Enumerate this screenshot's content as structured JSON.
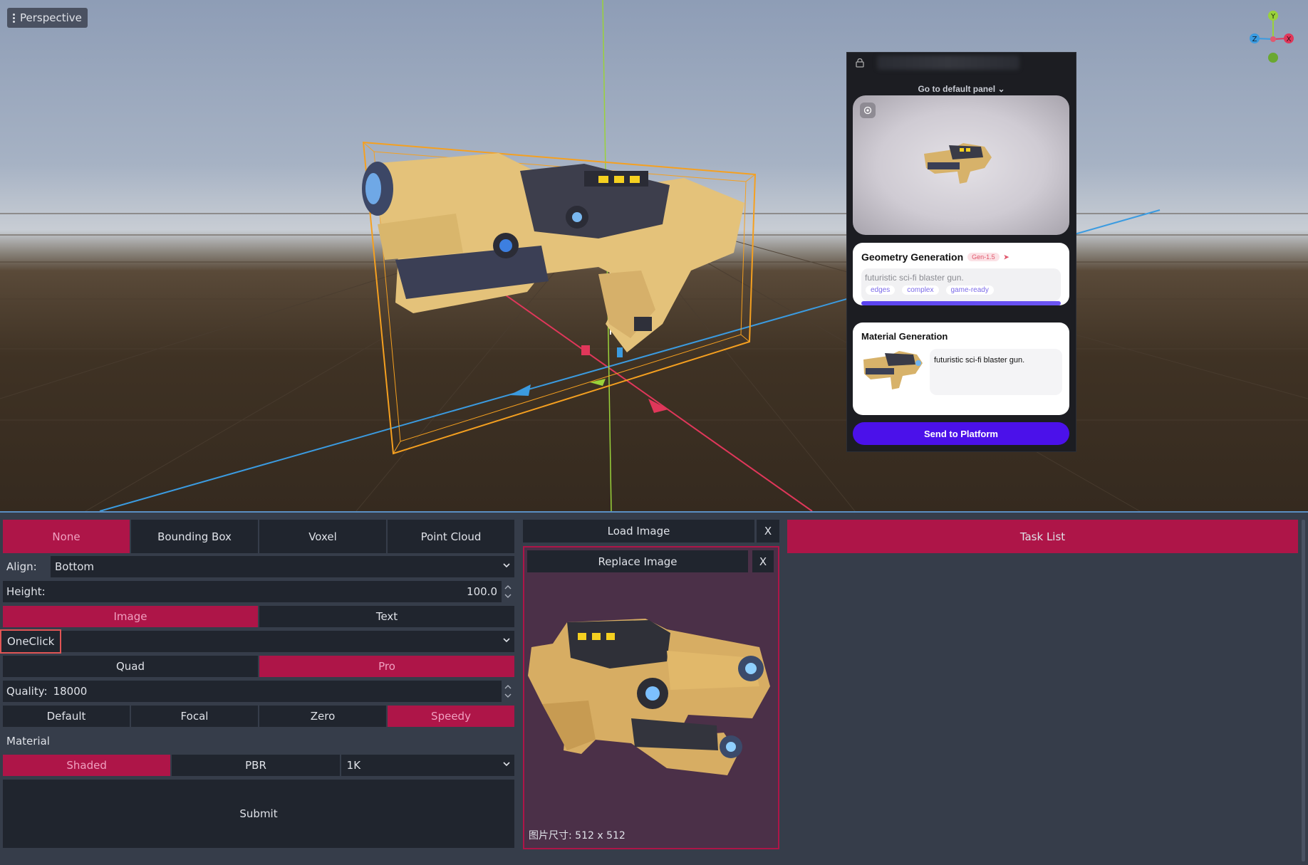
{
  "viewport": {
    "perspective_label": "Perspective",
    "gizmo": {
      "y": "Y",
      "x": "X",
      "z": "Z"
    }
  },
  "plugin": {
    "goto_label": "Go to default panel",
    "geometry": {
      "title": "Geometry Generation",
      "badge": "Gen-1.5",
      "prompt": "futuristic sci-fi blaster gun.",
      "chips": [
        "edges",
        "complex",
        "game-ready"
      ]
    },
    "material": {
      "title": "Material Generation",
      "prompt": "futuristic sci-fi blaster gun."
    },
    "send_label": "Send to Platform"
  },
  "left": {
    "mode_tabs": [
      "None",
      "Bounding Box",
      "Voxel",
      "Point Cloud"
    ],
    "mode_active": "None",
    "align_label": "Align:",
    "align_value": "Bottom",
    "height_label": "Height:",
    "height_value": "100.0",
    "input_tabs": [
      "Image",
      "Text"
    ],
    "input_active": "Image",
    "oneclick_label": "OneClick",
    "mesh_tabs": [
      "Quad",
      "Pro"
    ],
    "mesh_active": "Pro",
    "quality_label": "Quality:",
    "quality_value": "18000",
    "pose_tabs": [
      "Default",
      "Focal",
      "Zero",
      "Speedy"
    ],
    "pose_active": "Speedy",
    "material_label": "Material",
    "material_tabs": [
      "Shaded",
      "PBR"
    ],
    "material_active": "Shaded",
    "resolution_value": "1K",
    "submit_label": "Submit"
  },
  "middle": {
    "load_image_label": "Load Image",
    "close_label": "X",
    "replace_image_label": "Replace Image",
    "image_size_text": "图片尺寸: 512 x 512"
  },
  "right": {
    "task_list_label": "Task List"
  },
  "colors": {
    "accent": "#ae1548",
    "panel_bg": "#363d4a",
    "field_bg": "#20252e",
    "send_button": "#4b11ea"
  }
}
